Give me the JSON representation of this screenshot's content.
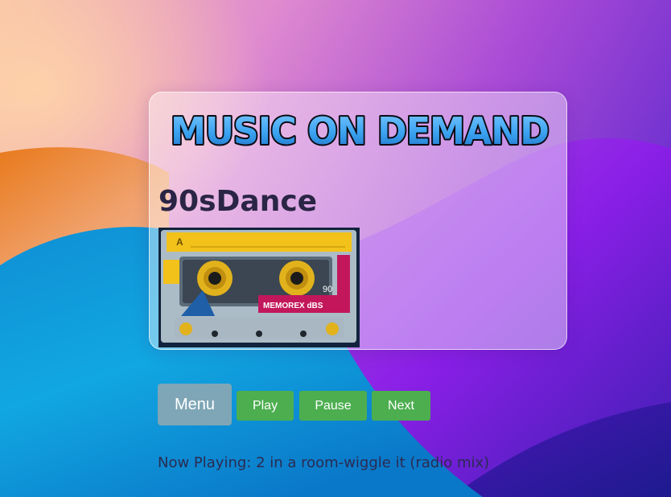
{
  "header": {
    "logo_text": "MUSIC ON DEMAND"
  },
  "station": {
    "title": "90sDance",
    "cover_image": "cassette-tape",
    "cover_brand": "MEMOREX dBS",
    "cover_side": "A",
    "cover_length": "90"
  },
  "controls": {
    "menu_label": "Menu",
    "play_label": "Play",
    "pause_label": "Pause",
    "next_label": "Next"
  },
  "status": {
    "now_playing": "Now Playing: 2 in a room-wiggle it (radio mix)"
  },
  "colors": {
    "menu_button": "#7fa6b6",
    "action_button": "#4cae4f",
    "logo_fill": "#3aa2f0",
    "title_text": "#2a2545"
  }
}
